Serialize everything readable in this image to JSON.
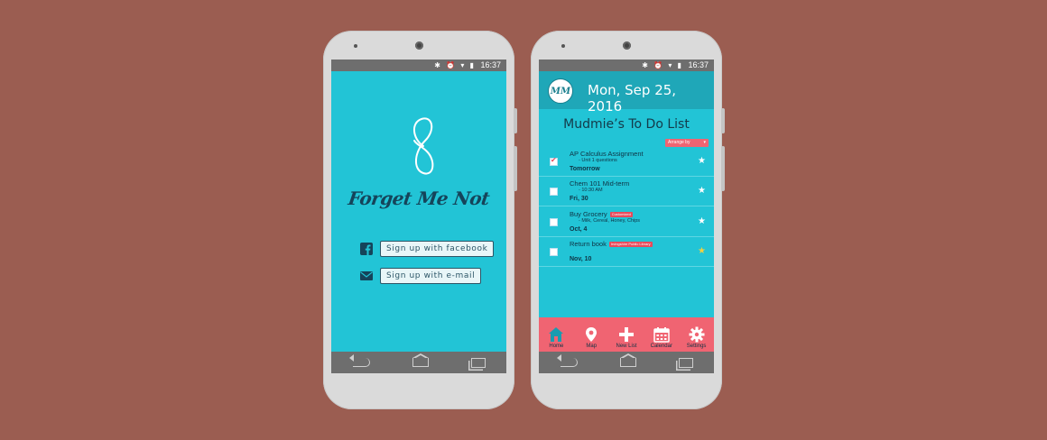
{
  "status_bar": {
    "icons": "✱ ⏰ ▾ ▮",
    "time": "16:37"
  },
  "screen1": {
    "brand": "Forget Me Not",
    "logo": "8",
    "facebook_icon": "facebook-icon",
    "email_icon": "mail-icon",
    "facebook_button": "Sign up with facebook",
    "email_button": "Sign up with e-mail"
  },
  "screen2": {
    "avatar": "MM",
    "date": "Mon, Sep 25, 2016",
    "list_title": "Mudmie’s To Do List",
    "arrange_label": "Arrange by",
    "arrange_caret": "▾",
    "tasks": [
      {
        "title": "AP Calculus Assignment",
        "tag": "",
        "sub": "-  Unit 1 questions",
        "due": "Tomorrow",
        "checked": true,
        "star": "white"
      },
      {
        "title": "Chem 101 Mid-term",
        "tag": "",
        "sub": "-  10:30 AM",
        "due": "Fri, 30",
        "checked": false,
        "star": "white"
      },
      {
        "title": "Buy Grocery",
        "tag": "Customized",
        "sub": "-  Milk, Cereal, Honey, Chips",
        "due": "Oct, 4",
        "checked": false,
        "star": "white"
      },
      {
        "title": "Return book",
        "tag": "Irvingshire Public Library",
        "sub": "",
        "due": "Nov, 10",
        "checked": false,
        "star": "gold"
      }
    ],
    "tabs": [
      {
        "label": "Home",
        "icon": "home-icon"
      },
      {
        "label": "Map",
        "icon": "map-pin-icon"
      },
      {
        "label": "New List",
        "icon": "plus-icon"
      },
      {
        "label": "Calendar",
        "icon": "calendar-icon"
      },
      {
        "label": "Settings",
        "icon": "gear-icon"
      }
    ]
  },
  "colors": {
    "background": "#9b5d51",
    "screen": "#22c4d6",
    "accent": "#f06472",
    "header": "#1fa7b8",
    "text_dark": "#0f3344"
  }
}
